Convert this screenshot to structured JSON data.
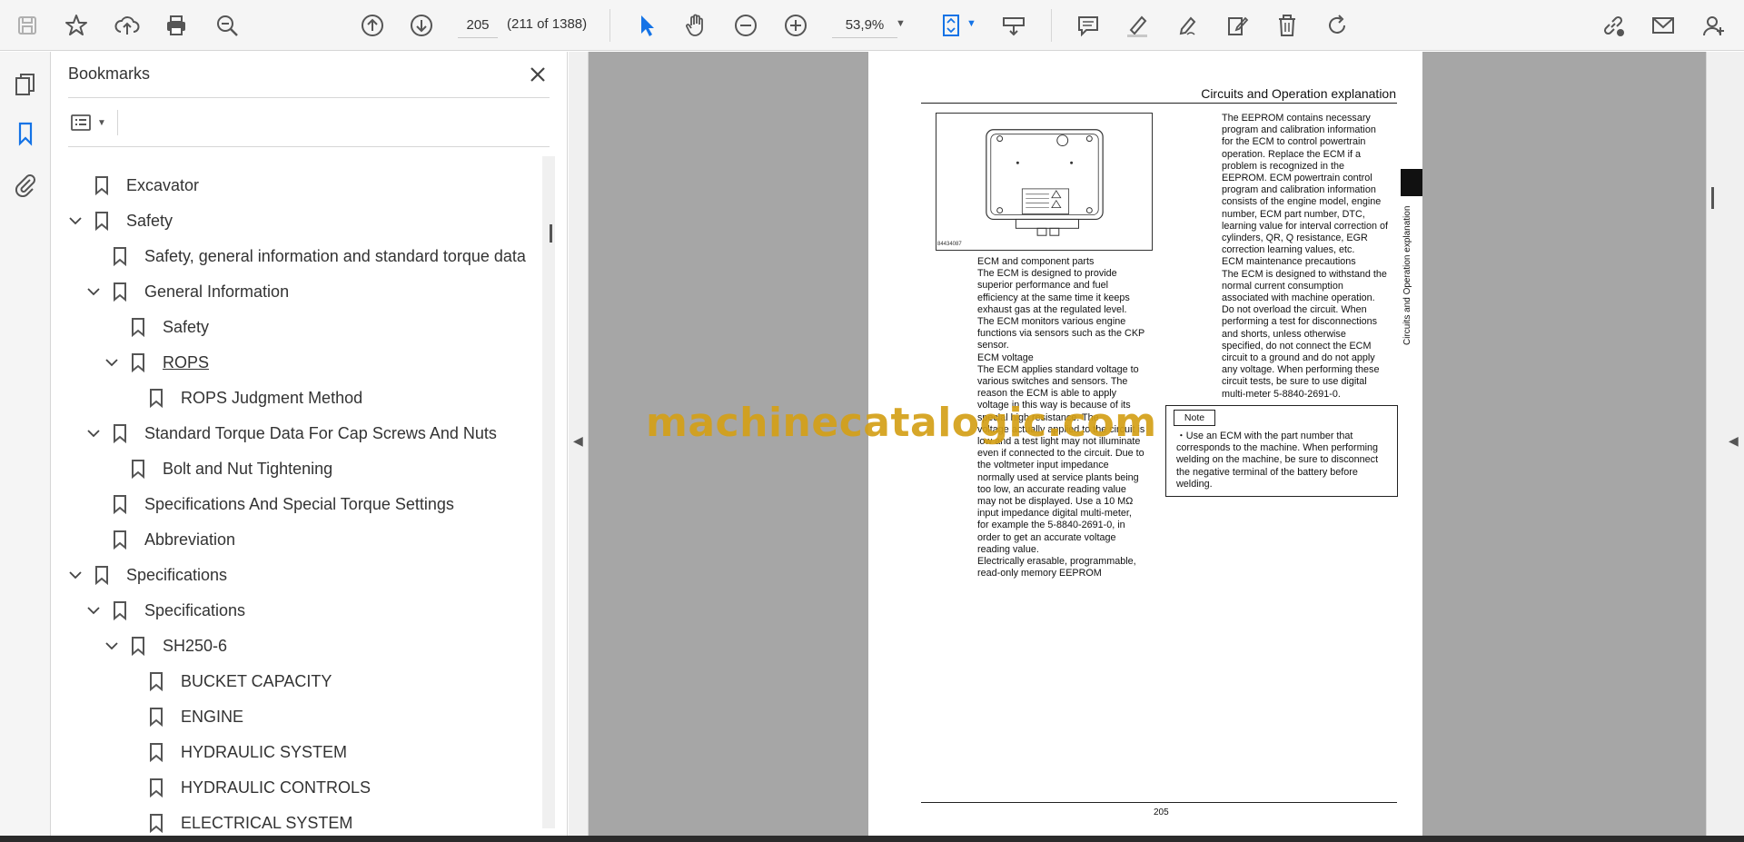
{
  "toolbar": {
    "page_number": "205",
    "page_count": "(211 of 1388)",
    "zoom": "53,9%"
  },
  "bookmarks": {
    "title": "Bookmarks",
    "items": [
      {
        "label": "Excavator",
        "level": 0,
        "expanded": null
      },
      {
        "label": "Safety",
        "level": 0,
        "expanded": true
      },
      {
        "label": "Safety, general information and standard torque data",
        "level": 1,
        "expanded": null
      },
      {
        "label": "General Information",
        "level": 1,
        "expanded": true
      },
      {
        "label": "Safety",
        "level": 2,
        "expanded": null
      },
      {
        "label": "ROPS",
        "level": 2,
        "expanded": true,
        "selected": true
      },
      {
        "label": "ROPS Judgment Method",
        "level": 3,
        "expanded": null
      },
      {
        "label": "Standard Torque Data For Cap Screws And Nuts",
        "level": 1,
        "expanded": true
      },
      {
        "label": "Bolt and Nut Tightening",
        "level": 2,
        "expanded": null
      },
      {
        "label": "Specifications And Special Torque Settings",
        "level": 1,
        "expanded": null
      },
      {
        "label": "Abbreviation",
        "level": 1,
        "expanded": null
      },
      {
        "label": "Specifications",
        "level": 0,
        "expanded": true
      },
      {
        "label": "Specifications",
        "level": 1,
        "expanded": true
      },
      {
        "label": "SH250-6",
        "level": 2,
        "expanded": true
      },
      {
        "label": "BUCKET CAPACITY",
        "level": 3,
        "expanded": null
      },
      {
        "label": "ENGINE",
        "level": 3,
        "expanded": null
      },
      {
        "label": "HYDRAULIC SYSTEM",
        "level": 3,
        "expanded": null
      },
      {
        "label": "HYDRAULIC CONTROLS",
        "level": 3,
        "expanded": null
      },
      {
        "label": "ELECTRICAL SYSTEM",
        "level": 3,
        "expanded": null
      }
    ]
  },
  "document": {
    "header": "Circuits and Operation explanation",
    "side_title": "Circuits and Operation explanation",
    "figure_code": "84434087",
    "col1": [
      "ECM and component parts",
      "The ECM is designed to provide",
      "superior performance and fuel",
      "efficiency at the same time it keeps",
      "exhaust gas at the regulated level.",
      "The ECM monitors various engine",
      "functions via sensors such as the CKP",
      "sensor.",
      "ECM voltage",
      "The ECM applies standard voltage to",
      "various switches and sensors. The",
      "reason the ECM is able to apply",
      "voltage in this way is because of its",
      "special high resistance. The",
      "voltage actually applied to the circuit is",
      "low and a test light may not illuminate",
      "even if connected to the circuit. Due to",
      "the voltmeter input impedance",
      "normally used at service plants being",
      "too low, an accurate reading value",
      "may not be displayed. Use a 10 MΩ",
      "input impedance digital multi-meter,",
      "for example the 5-8840-2691-0, in",
      "order to get an accurate voltage",
      "reading value.",
      "Electrically erasable, programmable,",
      "read-only memory EEPROM"
    ],
    "col2": [
      "The EEPROM contains necessary",
      "program and calibration information",
      "for the ECM to control powertrain",
      "operation. Replace the ECM if a",
      "problem is recognized in the",
      "EEPROM. ECM powertrain control",
      "program and calibration information",
      "consists of the engine model, engine",
      "number, ECM part number, DTC,",
      "learning value for interval correction of",
      "cylinders, QR, Q resistance, EGR",
      "correction learning values, etc.",
      "ECM maintenance precautions",
      "The ECM is designed to withstand the",
      "normal current consumption",
      "associated with machine operation.",
      "Do not overload the circuit. When",
      "performing a test for disconnections",
      "and shorts, unless otherwise",
      "specified, do not connect the ECM",
      "circuit to a ground and do not apply",
      "any voltage. When performing these",
      "circuit tests, be sure to use digital",
      "multi-meter 5-8840-2691-0."
    ],
    "note_label": "Note",
    "note_lines": [
      "・Use an ECM with the part number that",
      "corresponds to the machine. When performing",
      "welding on the machine, be sure to disconnect",
      "the negative terminal of the battery before",
      "welding."
    ],
    "page_num": "205"
  },
  "watermark": "machinecatalogic.com",
  "colors": {
    "toolbar_bg": "#f5f5f5",
    "doc_bg": "#a6a6a6",
    "accent": "#1473e6",
    "watermark": "#d4a017"
  }
}
